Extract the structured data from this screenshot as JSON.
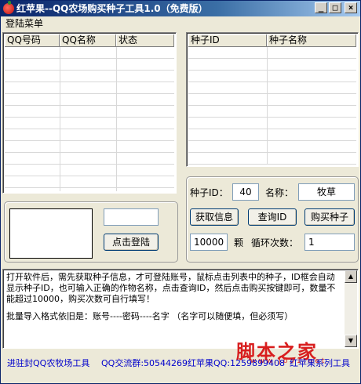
{
  "window": {
    "title": "红苹果--QQ农场购买种子工具1.0（免费版）",
    "minimize": "_",
    "maximize": "□",
    "close": "×"
  },
  "menu": {
    "login_menu": "登陆菜单"
  },
  "account_list": {
    "columns": [
      "QQ号码",
      "QQ名称",
      "状态"
    ]
  },
  "seed_list": {
    "columns": [
      "种子ID",
      "种子名称"
    ]
  },
  "login_panel": {
    "qq_input_value": "",
    "login_button": "点击登陆"
  },
  "seed_panel": {
    "seed_id_label": "种子ID：",
    "seed_id_value": "40",
    "name_label": "名称：",
    "name_value": "牧草",
    "get_info_button": "获取信息",
    "query_id_button": "查询ID",
    "buy_seed_button": "购买种子",
    "quantity_value": "10000",
    "quantity_unit": "颗",
    "loop_label": "循环次数：",
    "loop_value": "1"
  },
  "instructions": {
    "line1": "打开软件后，需先获取种子信息，才可登陆账号，鼠标点击列表中的种子，ID框会自动显示种子ID，也可输入正确的作物名称，点击查询ID，然后点击购买按键即可，数量不能超过10000，购买次数可自行填写！",
    "line2": "批量导入格式依旧是：账号----密码----名字 （名字可以随便填，但必须写）"
  },
  "footer": {
    "link_left": "进驻封QQ农牧场工具",
    "link_group": "QQ交流群:50544269红苹果QQ:1259899408",
    "link_series": "红苹果系列工具"
  },
  "watermark": {
    "text": "脚本之家",
    "sub": "www.jb51.net"
  }
}
